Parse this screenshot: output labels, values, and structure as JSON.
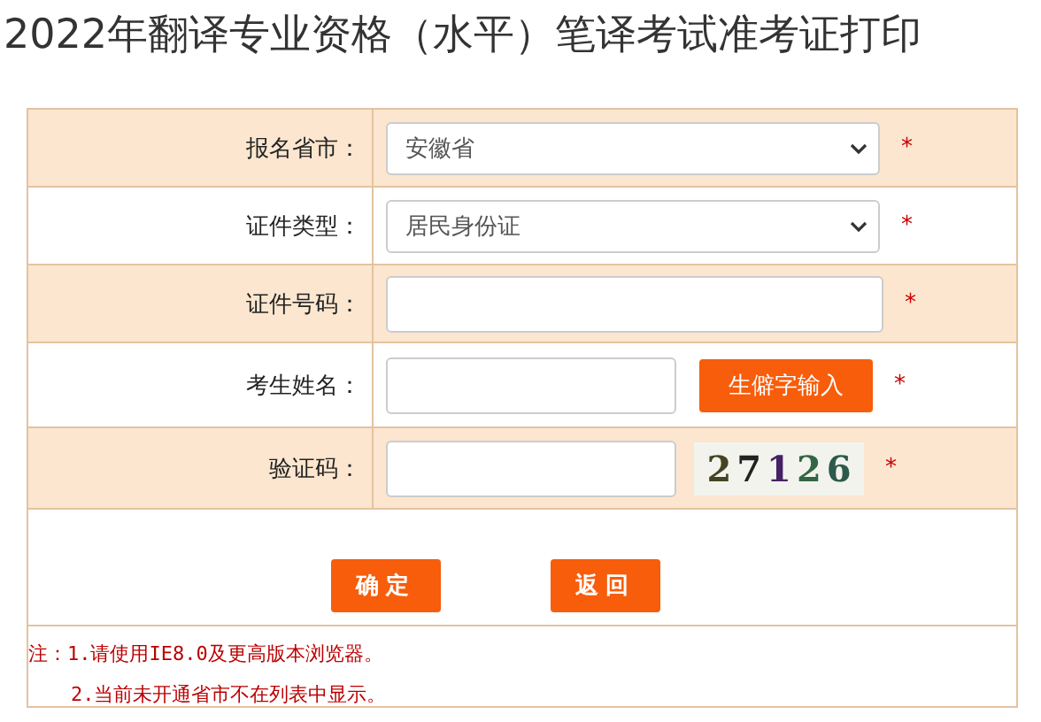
{
  "title": "2022年翻译专业资格（水平）笔译考试准考证打印",
  "form": {
    "rows": [
      {
        "label": "报名省市：",
        "kind": "select",
        "value": "安徽省",
        "required_mark": "*"
      },
      {
        "label": "证件类型：",
        "kind": "select",
        "value": "居民身份证",
        "required_mark": "*"
      },
      {
        "label": "证件号码：",
        "kind": "input",
        "required_mark": "*"
      },
      {
        "label": "考生姓名：",
        "kind": "input_button",
        "button": "生僻字输入",
        "required_mark": "*"
      },
      {
        "label": "验证码：",
        "kind": "captcha",
        "captcha": "27126",
        "required_mark": "*"
      }
    ],
    "buttons": [
      "确定",
      "返回"
    ],
    "notes": [
      "注：1.请使用IE8.0及更高版本浏览器。",
      "2.当前未开通省市不在列表中显示。"
    ]
  }
}
